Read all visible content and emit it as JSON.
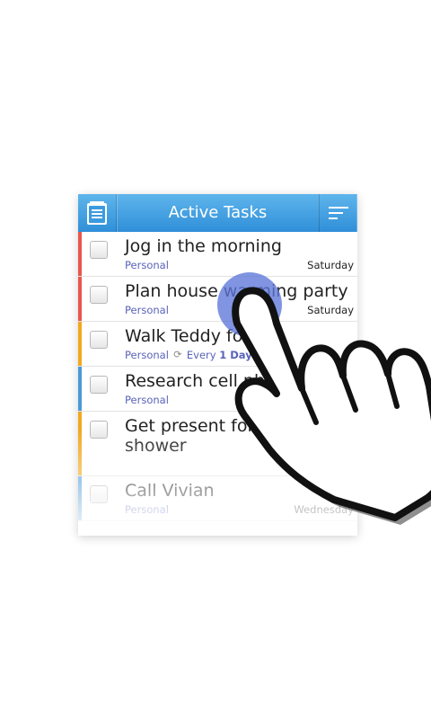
{
  "header": {
    "title": "Active Tasks",
    "left_icon": "tasks-list-icon",
    "right_icon": "sort-icon"
  },
  "tasks": [
    {
      "title": "Jog in the morning",
      "list": "Personal",
      "due": "Saturday",
      "stripe": "#e8574d",
      "repeat": null
    },
    {
      "title": "Plan house warming party",
      "list": "Personal",
      "due": "Saturday",
      "stripe": "#e8574d",
      "repeat": null
    },
    {
      "title": "Walk Teddy for ",
      "list": "Personal",
      "due": "",
      "stripe": "#f1a81f",
      "repeat": {
        "prefix": "Every",
        "value": "1 Day"
      }
    },
    {
      "title": "Research cell pho",
      "list": "Personal",
      "due": "",
      "stripe": "#4a9ad8",
      "repeat": null
    },
    {
      "title": "Get present for y\nshower",
      "list": "",
      "due": "",
      "stripe": "#f1a81f",
      "repeat": null
    },
    {
      "title": "Call Vivian",
      "list": "Personal",
      "due": "Wednesday",
      "stripe": "#4a9ad8",
      "repeat": null
    }
  ],
  "colors": {
    "titlebar_top": "#5fb5ec",
    "titlebar_bottom": "#2f8fd8",
    "list_label": "#5a63b8",
    "tap_circle": "#5c76d8"
  },
  "overlay": {
    "icon": "pointing-hand-icon"
  }
}
